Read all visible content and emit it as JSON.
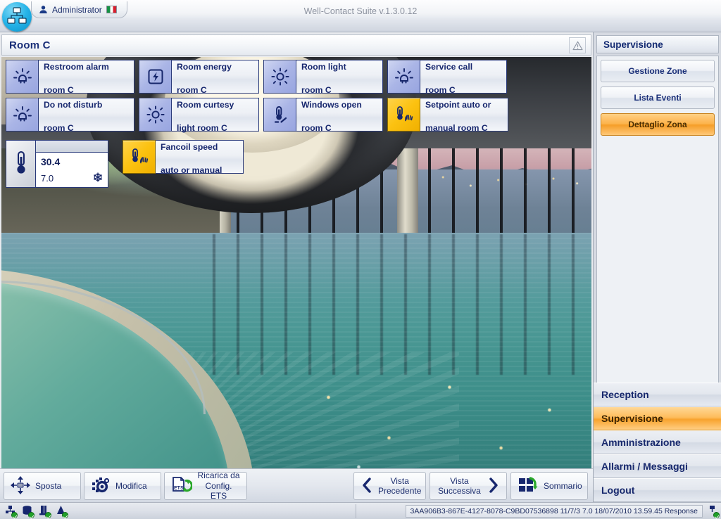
{
  "titlebar": {
    "logo_icon": "network-computers-icon",
    "user_icon": "user-icon",
    "user_label": "Administrator",
    "flag_icon": "italy-flag-icon",
    "app_title": "Well-Contact Suite v.1.3.0.12"
  },
  "main": {
    "header_title": "Room C",
    "warning_icon": "warning-triangle-icon",
    "background_image": "hotel-infinity-pool-at-dusk"
  },
  "widgets": [
    {
      "icon": "alarm-light-icon",
      "state": "normal",
      "line1": "Restroom alarm",
      "line2": "room C"
    },
    {
      "icon": "lightning-bolt-icon",
      "state": "normal",
      "line1": "Room energy",
      "line2": "room C"
    },
    {
      "icon": "room-light-icon",
      "state": "normal",
      "line1": "Room light",
      "line2": "room C"
    },
    {
      "icon": "service-call-icon",
      "state": "normal",
      "line1": "Service call",
      "line2": "room C"
    },
    {
      "icon": "alarm-light-icon",
      "state": "normal",
      "line1": "Do not disturb",
      "line2": "room C"
    },
    {
      "icon": "courtesy-light-icon",
      "state": "normal",
      "line1": "Room curtesy",
      "line2": "light room C"
    },
    {
      "icon": "window-open-icon",
      "state": "normal",
      "line1": "Windows open",
      "line2": "room C"
    },
    {
      "icon": "thermostat-hand-icon",
      "state": "amber",
      "line1": "Setpoint auto or",
      "line2": "manual room C"
    },
    {
      "icon": "thermostat-hand-icon",
      "state": "amber",
      "line1": "Fancoil speed",
      "line2": "auto or manual"
    }
  ],
  "temperature": {
    "icon": "thermometer-icon",
    "current_value": "30.4",
    "setpoint_value": "7.0",
    "mode_icon": "snowflake-icon"
  },
  "sidebar": {
    "title": "Supervisione",
    "buttons": [
      {
        "label": "Gestione Zone",
        "active": false
      },
      {
        "label": "Lista Eventi",
        "active": false
      },
      {
        "label": "Dettaglio Zona",
        "active": true
      }
    ]
  },
  "nav": {
    "items": [
      {
        "label": "Reception",
        "active": false
      },
      {
        "label": "Supervisione",
        "active": true
      },
      {
        "label": "Amministrazione",
        "active": false
      },
      {
        "label": "Allarmi / Messaggi",
        "active": false
      },
      {
        "label": "Logout",
        "active": false
      }
    ]
  },
  "toolbar": {
    "move_label": "Sposta",
    "move_icon": "move-arrows-icon",
    "edit_label": "Modifica",
    "edit_icon": "gear-pixels-icon",
    "reload_label": "Ricarica da\nConfig. ETS",
    "reload_icon": "ets-refresh-icon",
    "prev_label": "Vista\nPrecedente",
    "prev_icon": "chevron-left-icon",
    "next_label": "Vista\nSuccessiva",
    "next_icon": "chevron-right-icon",
    "summary_label": "Sommario",
    "summary_icon": "summary-blocks-icon"
  },
  "statusbar": {
    "icons": [
      "knx-bus-status-icon",
      "database-status-icon",
      "server-status-icon",
      "alarm-status-icon"
    ],
    "message": "3AA906B3-867E-4127-8078-C9BD07536898 11/7/3 7.0 18/07/2010 13.59.45 Response",
    "trailing_icon": "connection-status-icon"
  },
  "colors": {
    "accent_orange": "#f8a32e",
    "widget_blue": "#aab5e6",
    "widget_amber": "#fcc211",
    "text_navy": "#17276e"
  }
}
